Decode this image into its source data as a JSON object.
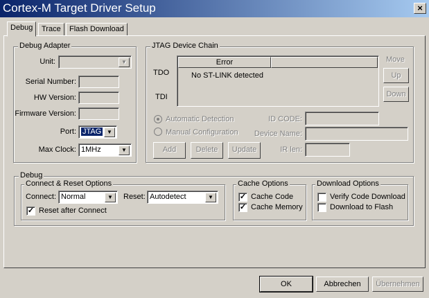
{
  "window": {
    "title": "Cortex-M Target Driver Setup",
    "close": "×"
  },
  "tabs": [
    {
      "label": "Debug"
    },
    {
      "label": "Trace"
    },
    {
      "label": "Flash Download"
    }
  ],
  "debug_adapter": {
    "title": "Debug Adapter",
    "unit_label": "Unit:",
    "unit_value": "",
    "serial_label": "Serial Number:",
    "hw_label": "HW Version:",
    "fw_label": "Firmware Version:",
    "port_label": "Port:",
    "port_value": "JTAG",
    "clock_label": "Max Clock:",
    "clock_value": "1MHz"
  },
  "jtag": {
    "title": "JTAG Device Chain",
    "column_error": "Error",
    "column_2": "",
    "tdo": "TDO",
    "tdi": "TDI",
    "message": "No ST-LINK detected",
    "move": "Move",
    "up": "Up",
    "down": "Down",
    "auto": "Automatic Detection",
    "manual": "Manual Configuration",
    "id_code": "ID CODE:",
    "device_name": "Device Name:",
    "ir_len": "IR len:",
    "add": "Add",
    "delete": "Delete",
    "update": "Update"
  },
  "debug": {
    "title": "Debug",
    "connect_reset": {
      "title": "Connect & Reset Options",
      "connect_label": "Connect:",
      "connect_value": "Normal",
      "reset_label": "Reset:",
      "reset_value": "Autodetect",
      "reset_after": "Reset after Connect",
      "reset_after_checked": true
    },
    "cache": {
      "title": "Cache Options",
      "code": "Cache Code",
      "code_checked": true,
      "memory": "Cache Memory",
      "memory_checked": true
    },
    "download": {
      "title": "Download Options",
      "verify": "Verify Code Download",
      "verify_checked": false,
      "to_flash": "Download to Flash",
      "to_flash_checked": false
    }
  },
  "buttons": {
    "ok": "OK",
    "cancel": "Abbrechen",
    "apply": "Übernehmen"
  },
  "glyphs": {
    "arrow": "▼",
    "check": "✓"
  }
}
